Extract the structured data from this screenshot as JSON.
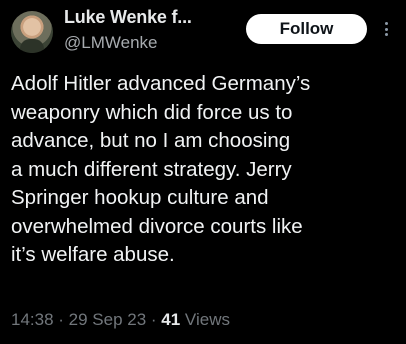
{
  "author": {
    "display_name": "Luke Wenke f...",
    "handle": "@LMWenke"
  },
  "follow_button": {
    "label": "Follow"
  },
  "more_menu": {
    "icon": "more-vertical-icon"
  },
  "tweet": {
    "text": "Adolf Hitler advanced Germany’s\nweaponry which did force us to\nadvance, but no I am choosing\na much different strategy.  Jerry\nSpringer hookup culture and\noverwhelmed divorce courts like\nit’s welfare abuse."
  },
  "meta": {
    "time": "14:38",
    "separator": " · ",
    "date": "29 Sep 23",
    "views_count": "41",
    "views_label": " Views"
  },
  "colors": {
    "background": "#000000",
    "text": "#e7e9ea",
    "secondary_text": "#71767b",
    "follow_bg": "#ffffff"
  }
}
